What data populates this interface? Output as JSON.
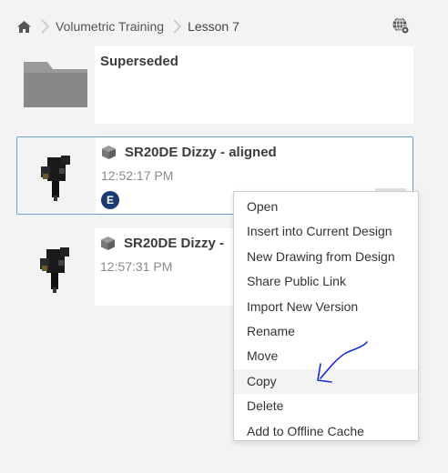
{
  "breadcrumb": {
    "items": [
      {
        "label": "Volumetric Training"
      },
      {
        "label": "Lesson 7"
      }
    ]
  },
  "cards": [
    {
      "title": "Superseded"
    },
    {
      "title": "SR20DE Dizzy - aligned",
      "time": "12:52:17 PM",
      "badge": "E"
    },
    {
      "title": "SR20DE Dizzy -",
      "time": "12:57:31 PM"
    }
  ],
  "context_menu": {
    "items": [
      "Open",
      "Insert into Current Design",
      "New Drawing from Design",
      "Share Public Link",
      "Import New Version",
      "Rename",
      "Move",
      "Copy",
      "Delete",
      "Add to Offline Cache"
    ],
    "highlighted": "Copy"
  },
  "colors": {
    "background": "#f3f3f3",
    "selection_border": "#6aa3d6",
    "badge": "#1b3a73",
    "annotation_ink": "#1a2bd6"
  },
  "icons": [
    "home-icon",
    "chevron-right-icon",
    "globe-icon",
    "folder-icon",
    "cube-icon",
    "arrow-annotation"
  ]
}
